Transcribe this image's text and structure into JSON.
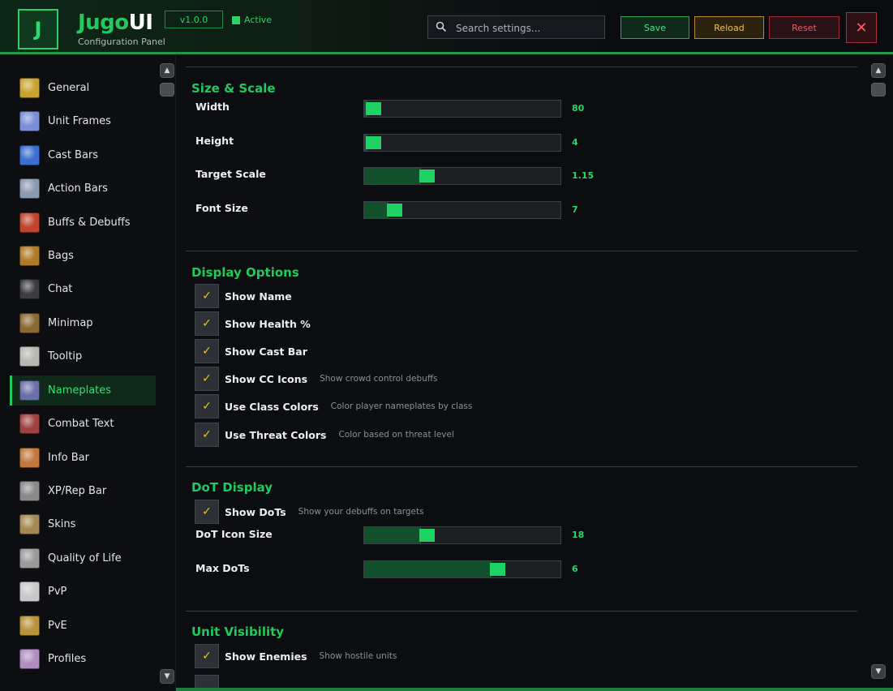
{
  "header": {
    "logo_letter": "J",
    "brand_a": "Jugo",
    "brand_b": "UI",
    "subtitle": "Configuration Panel",
    "version": "v1.0.0",
    "status": "Active",
    "search_placeholder": "Search settings...",
    "save_label": "Save",
    "reload_label": "Reload",
    "reset_label": "Reset",
    "close_glyph": "✕"
  },
  "colors": {
    "accent": "#22c95c",
    "save": "#2aa35a",
    "reload": "#b88b22",
    "reset": "#9a2e34",
    "checkmark": "#f0c419"
  },
  "sidebar": {
    "items": [
      {
        "label": "General",
        "icon": "gears-icon",
        "color": "#c9a22e"
      },
      {
        "label": "Unit Frames",
        "icon": "sparkle-icon",
        "color": "#7a8fd8"
      },
      {
        "label": "Cast Bars",
        "icon": "orb-icon",
        "color": "#3a6fd0"
      },
      {
        "label": "Action Bars",
        "icon": "hammer-icon",
        "color": "#8a9ab0"
      },
      {
        "label": "Buffs & Debuffs",
        "icon": "shield-icon",
        "color": "#c0442e"
      },
      {
        "label": "Bags",
        "icon": "bag-icon",
        "color": "#b07a2a"
      },
      {
        "label": "Chat",
        "icon": "chat-icon",
        "color": "#3b3d42"
      },
      {
        "label": "Minimap",
        "icon": "map-icon",
        "color": "#8a6a34"
      },
      {
        "label": "Tooltip",
        "icon": "scroll-icon",
        "color": "#b8b8b0"
      },
      {
        "label": "Nameplates",
        "icon": "sword-icon",
        "color": "#6a6fa8"
      },
      {
        "label": "Combat Text",
        "icon": "text-icon",
        "color": "#a04040"
      },
      {
        "label": "Info Bar",
        "icon": "hand-icon",
        "color": "#c2783a"
      },
      {
        "label": "XP/Rep Bar",
        "icon": "wings-icon",
        "color": "#8a8a8a"
      },
      {
        "label": "Skins",
        "icon": "crate-icon",
        "color": "#a58852"
      },
      {
        "label": "Quality of Life",
        "icon": "gear-icon",
        "color": "#9a9a9a"
      },
      {
        "label": "PvP",
        "icon": "crossed-swords-icon",
        "color": "#c8c8c8"
      },
      {
        "label": "PvE",
        "icon": "helm-icon",
        "color": "#b8913a"
      },
      {
        "label": "Profiles",
        "icon": "portrait-icon",
        "color": "#b08cc0"
      }
    ],
    "active_index": 9
  },
  "sections": {
    "size_scale": {
      "title": "Size & Scale",
      "sliders": [
        {
          "label": "Width",
          "value": "80",
          "fraction": 0.0
        },
        {
          "label": "Height",
          "value": "4",
          "fraction": 0.0
        },
        {
          "label": "Target Scale",
          "value": "1.15",
          "fraction": 0.3
        },
        {
          "label": "Font Size",
          "value": "7",
          "fraction": 0.12
        }
      ]
    },
    "display": {
      "title": "Display Options",
      "checks": [
        {
          "label": "Show Name",
          "desc": ""
        },
        {
          "label": "Show Health %",
          "desc": ""
        },
        {
          "label": "Show Cast Bar",
          "desc": ""
        },
        {
          "label": "Show CC Icons",
          "desc": "Show crowd control debuffs"
        },
        {
          "label": "Use Class Colors",
          "desc": "Color player nameplates by class"
        },
        {
          "label": "Use Threat Colors",
          "desc": "Color based on threat level"
        }
      ]
    },
    "dot": {
      "title": "DoT Display",
      "check": {
        "label": "Show DoTs",
        "desc": "Show your debuffs on targets"
      },
      "sliders": [
        {
          "label": "DoT Icon Size",
          "value": "18",
          "fraction": 0.3
        },
        {
          "label": "Max DoTs",
          "value": "6",
          "fraction": 0.7
        }
      ]
    },
    "visibility": {
      "title": "Unit Visibility",
      "check": {
        "label": "Show Enemies",
        "desc": "Show hostile units"
      }
    }
  },
  "checkmark": "✓"
}
